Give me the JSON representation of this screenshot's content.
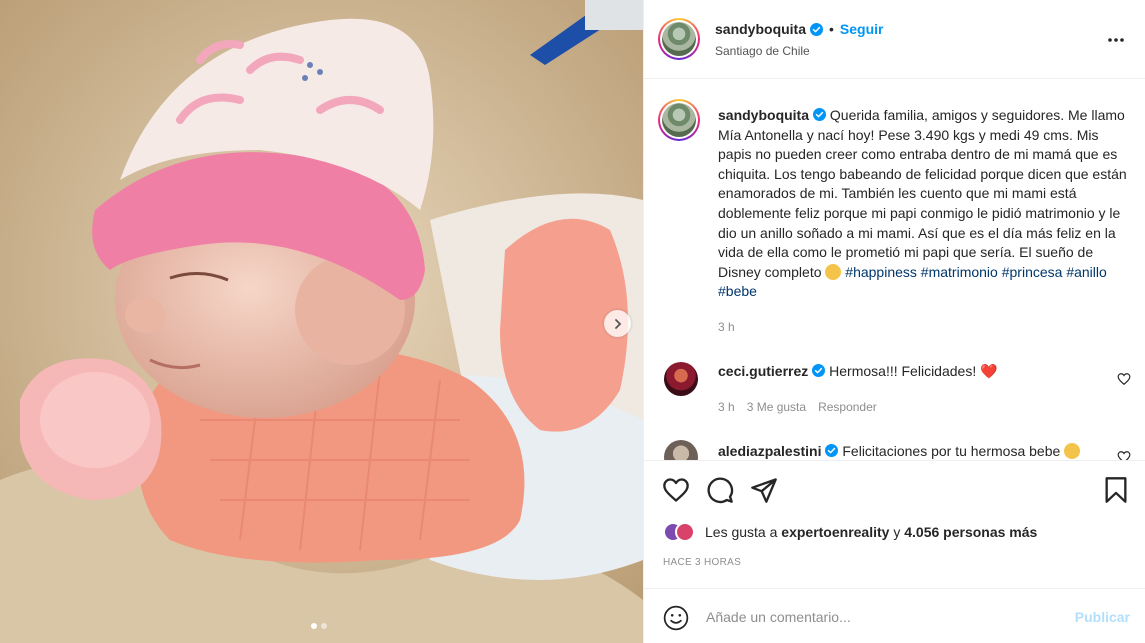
{
  "post": {
    "username": "sandyboquita",
    "follow_label": "Seguir",
    "separator": "•",
    "location": "Santiago de Chile"
  },
  "caption": {
    "username": "sandyboquita",
    "text": "Querida familia, amigos y seguidores. Me llamo Mía Antonella y nací hoy! Pese 3.490 kgs y medi 49 cms. Mis papis no pueden creer como entraba dentro de mi mamá que es chiquita. Los tengo babeando de felicidad porque dicen que están enamorados de mi. También les cuento que mi mami está doblemente feliz porque mi papi conmigo le pidió matrimonio y le dio un anillo soñado a mi mami. Así que es el día más feliz en la vida de ella como le prometió mi papi que sería. El sueño de Disney completo",
    "hashtags": [
      "#happiness",
      "#matrimonio",
      "#princesa",
      "#anillo",
      "#bebe"
    ],
    "time": "3 h"
  },
  "comments": [
    {
      "username": "ceci.gutierrez",
      "text": "Hermosa!!! Felicidades!",
      "emoji": "❤️",
      "time": "3 h",
      "likes": "3 Me gusta",
      "reply_label": "Responder"
    },
    {
      "username": "alediazpalestini",
      "text": "Felicitaciones por tu hermosa bebe"
    }
  ],
  "likes": {
    "prefix": "Les gusta a",
    "user": "expertoenreality",
    "connector": "y",
    "others": "4.056 personas más"
  },
  "posted": "HACE 3 HORAS",
  "composer": {
    "placeholder": "Añade un comentario...",
    "publish_label": "Publicar"
  },
  "colors": {
    "accent": "#0095f6",
    "hashtag": "#00376b",
    "publish_disabled": "#b2dffc",
    "muted": "#8e8e8e"
  },
  "icons": [
    "verified-badge-icon",
    "more-options-icon",
    "heart-icon",
    "comment-icon",
    "share-icon",
    "bookmark-icon",
    "emoji-icon",
    "chevron-right-icon"
  ],
  "carousel": {
    "count": 2,
    "active": 1
  }
}
